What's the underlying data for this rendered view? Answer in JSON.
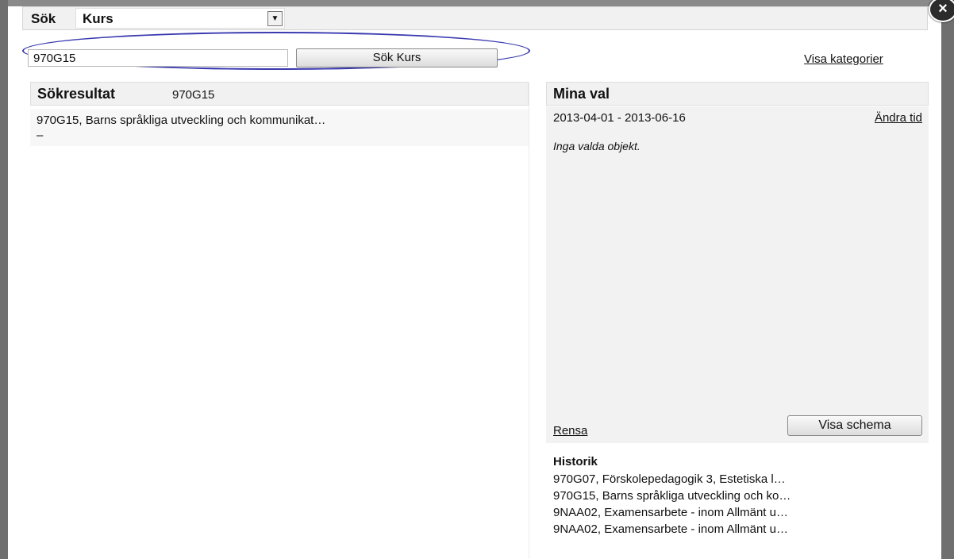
{
  "search": {
    "label": "Sök",
    "type_selected": "Kurs",
    "input_value": "970G15",
    "button_label": "Sök Kurs",
    "show_categories": "Visa kategorier"
  },
  "results": {
    "title": "Sökresultat",
    "query": "970G15",
    "items": [
      {
        "line1": "970G15, Barns språkliga utveckling och kommunikat…",
        "line2": "–"
      }
    ]
  },
  "my_selection": {
    "title": "Mina val",
    "date_range": "2013-04-01 - 2013-06-16",
    "change_time": "Ändra tid",
    "empty_text": "Inga valda objekt.",
    "clear": "Rensa",
    "show_schedule": "Visa schema"
  },
  "history": {
    "title": "Historik",
    "items": [
      "970G07, Förskolepedagogik 3, Estetiska l…",
      "970G15, Barns språkliga utveckling och ko…",
      "9NAA02, Examensarbete - inom Allmänt u…",
      "9NAA02, Examensarbete - inom Allmänt u…"
    ]
  },
  "icons": {
    "close": "close-icon",
    "dropdown": "chevron-down-icon"
  },
  "colors": {
    "highlight_oval": "#3a3ab0",
    "panel_bg": "#f2f2f2"
  }
}
